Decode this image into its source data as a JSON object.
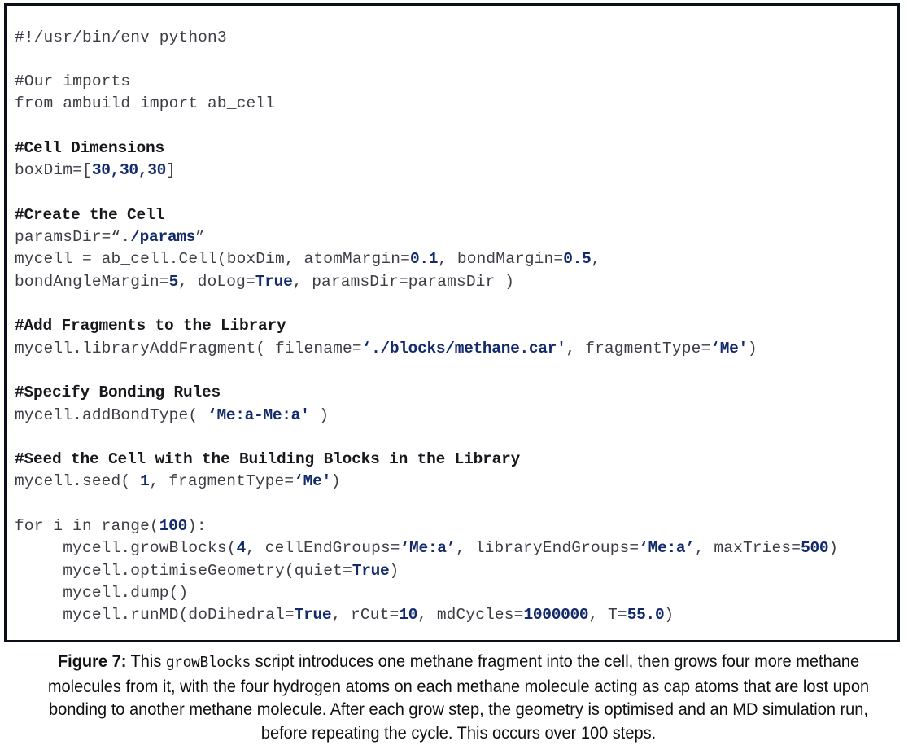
{
  "figure": {
    "code_box": {
      "language": "python",
      "lines": [
        {
          "type": "code",
          "segments": [
            {
              "text": "#!/usr/bin/env python3",
              "style": "plain"
            }
          ]
        },
        {
          "type": "blank",
          "segments": []
        },
        {
          "type": "comment",
          "segments": [
            {
              "text": "#Our imports",
              "style": "plain"
            }
          ]
        },
        {
          "type": "code",
          "segments": [
            {
              "text": "from ambuild import ab_cell",
              "style": "plain"
            }
          ]
        },
        {
          "type": "blank",
          "segments": []
        },
        {
          "type": "comment-bold",
          "segments": [
            {
              "text": "#Cell Dimensions",
              "style": "bold"
            }
          ]
        },
        {
          "type": "code",
          "segments": [
            {
              "text": "boxDim=[",
              "style": "plain"
            },
            {
              "text": "30,30,30",
              "style": "literal"
            },
            {
              "text": "]",
              "style": "plain"
            }
          ]
        },
        {
          "type": "blank",
          "segments": []
        },
        {
          "type": "comment-bold",
          "segments": [
            {
              "text": "#Create the Cell",
              "style": "bold"
            }
          ]
        },
        {
          "type": "code",
          "segments": [
            {
              "text": "paramsDir=“.",
              "style": "plain"
            },
            {
              "text": "/params",
              "style": "literal"
            },
            {
              "text": "”",
              "style": "plain"
            }
          ]
        },
        {
          "type": "code",
          "segments": [
            {
              "text": "mycell = ab_cell.Cell(boxDim, atomMargin=",
              "style": "plain"
            },
            {
              "text": "0.1",
              "style": "literal"
            },
            {
              "text": ", bondMargin=",
              "style": "plain"
            },
            {
              "text": "0.5",
              "style": "literal"
            },
            {
              "text": ",",
              "style": "plain"
            }
          ]
        },
        {
          "type": "code",
          "segments": [
            {
              "text": "bondAngleMargin=",
              "style": "plain"
            },
            {
              "text": "5",
              "style": "literal"
            },
            {
              "text": ", doLog=",
              "style": "plain"
            },
            {
              "text": "True",
              "style": "literal"
            },
            {
              "text": ", paramsDir=paramsDir )",
              "style": "plain"
            }
          ]
        },
        {
          "type": "blank",
          "segments": []
        },
        {
          "type": "comment-bold",
          "segments": [
            {
              "text": "#Add Fragments to the Library",
              "style": "bold"
            }
          ]
        },
        {
          "type": "code",
          "segments": [
            {
              "text": "mycell.libraryAddFragment( filename=",
              "style": "plain"
            },
            {
              "text": "‘./blocks/methane.car'",
              "style": "literal"
            },
            {
              "text": ", fragmentType=",
              "style": "plain"
            },
            {
              "text": "‘Me'",
              "style": "literal"
            },
            {
              "text": ")",
              "style": "plain"
            }
          ]
        },
        {
          "type": "blank",
          "segments": []
        },
        {
          "type": "comment-bold",
          "segments": [
            {
              "text": "#Specify Bonding Rules",
              "style": "bold"
            }
          ]
        },
        {
          "type": "code",
          "segments": [
            {
              "text": "mycell.addBondType( ",
              "style": "plain"
            },
            {
              "text": "‘Me:a-Me:a'",
              "style": "literal"
            },
            {
              "text": " )",
              "style": "plain"
            }
          ]
        },
        {
          "type": "blank",
          "segments": []
        },
        {
          "type": "comment-bold",
          "segments": [
            {
              "text": "#Seed the Cell with the Building Blocks in the Library",
              "style": "bold"
            }
          ]
        },
        {
          "type": "code",
          "segments": [
            {
              "text": "mycell.seed( ",
              "style": "plain"
            },
            {
              "text": "1",
              "style": "literal"
            },
            {
              "text": ", fragmentType=",
              "style": "plain"
            },
            {
              "text": "‘Me'",
              "style": "literal"
            },
            {
              "text": ")",
              "style": "plain"
            }
          ]
        },
        {
          "type": "blank",
          "segments": []
        },
        {
          "type": "code",
          "segments": [
            {
              "text": "for i in range(",
              "style": "plain"
            },
            {
              "text": "100",
              "style": "literal"
            },
            {
              "text": "):",
              "style": "plain"
            }
          ]
        },
        {
          "type": "code",
          "segments": [
            {
              "text": "     mycell.growBlocks(",
              "style": "plain"
            },
            {
              "text": "4",
              "style": "literal"
            },
            {
              "text": ", cellEndGroups=",
              "style": "plain"
            },
            {
              "text": "‘Me:a’",
              "style": "literal"
            },
            {
              "text": ", libraryEndGroups=",
              "style": "plain"
            },
            {
              "text": "‘Me:a’",
              "style": "literal"
            },
            {
              "text": ", maxTries=",
              "style": "plain"
            },
            {
              "text": "500",
              "style": "literal"
            },
            {
              "text": ")",
              "style": "plain"
            }
          ]
        },
        {
          "type": "code",
          "segments": [
            {
              "text": "     mycell.optimiseGeometry(quiet=",
              "style": "plain"
            },
            {
              "text": "True",
              "style": "literal"
            },
            {
              "text": ")",
              "style": "plain"
            }
          ]
        },
        {
          "type": "code",
          "segments": [
            {
              "text": "     mycell.dump()",
              "style": "plain"
            }
          ]
        },
        {
          "type": "code",
          "segments": [
            {
              "text": "     mycell.runMD(doDihedral=",
              "style": "plain"
            },
            {
              "text": "True",
              "style": "literal"
            },
            {
              "text": ", rCut=",
              "style": "plain"
            },
            {
              "text": "10",
              "style": "literal"
            },
            {
              "text": ", mdCycles=",
              "style": "plain"
            },
            {
              "text": "1000000",
              "style": "literal"
            },
            {
              "text": ", T=",
              "style": "plain"
            },
            {
              "text": "55.0",
              "style": "literal"
            },
            {
              "text": ")",
              "style": "plain"
            }
          ]
        }
      ]
    },
    "caption": {
      "label": "Figure 7:",
      "text_before_code": " This ",
      "code_term": "growBlocks",
      "text_after_code": " script introduces one methane fragment into the cell, then grows four more methane molecules from it, with the four hydrogen atoms on each methane molecule acting as cap atoms that are lost upon bonding to another methane molecule. After each grow step, the geometry is optimised and an MD simulation run, before repeating the cycle. This occurs over 100 steps."
    },
    "colors": {
      "border": "#0b0f1a",
      "code_text": "#3d3d46",
      "comment_bold": "#17171c",
      "literal": "#132a6b",
      "caption_text": "#101010",
      "background": "#ffffff"
    }
  }
}
